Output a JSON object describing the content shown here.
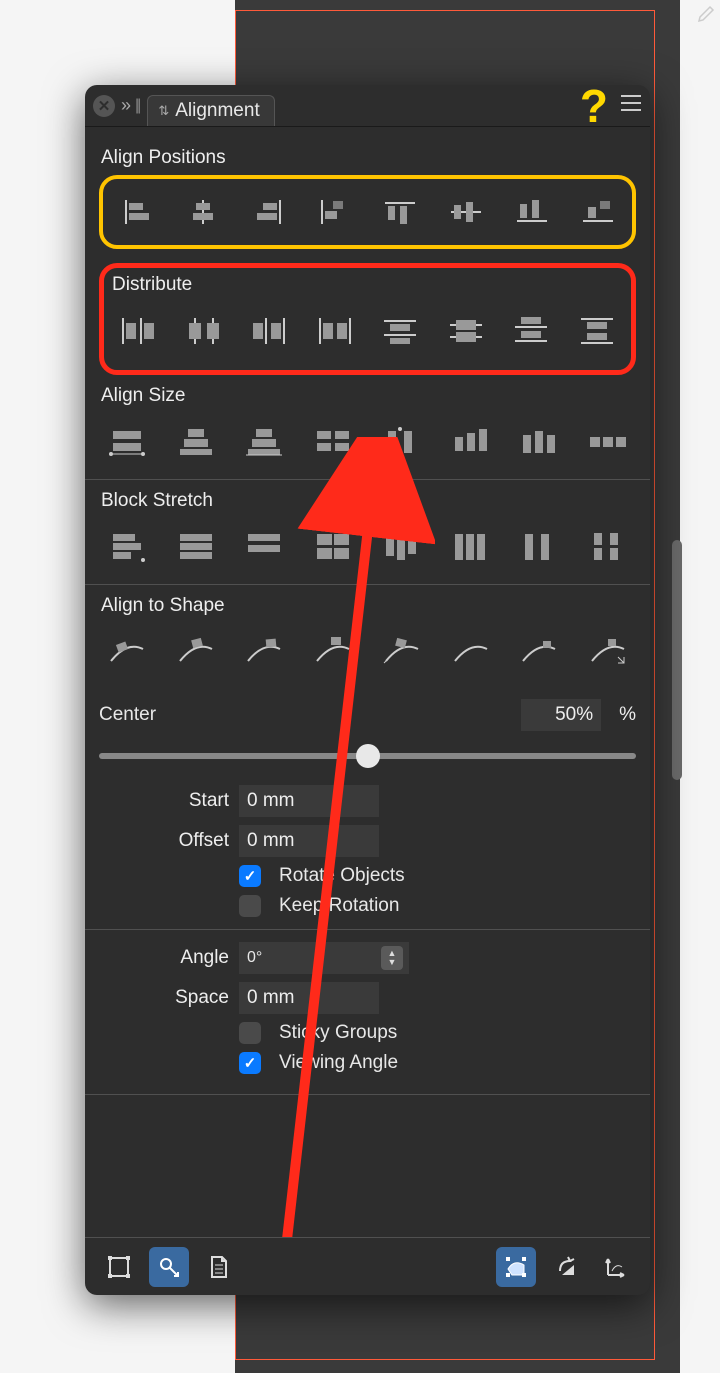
{
  "panel": {
    "title": "Alignment",
    "sections": {
      "align_positions": "Align Positions",
      "distribute": "Distribute",
      "align_size": "Align Size",
      "block_stretch": "Block Stretch",
      "align_to_shape": "Align to Shape"
    },
    "center": {
      "label": "Center",
      "percent_value": "50%",
      "percent_suffix": "%"
    },
    "fields": {
      "start": {
        "label": "Start",
        "value": "0 mm"
      },
      "offset": {
        "label": "Offset",
        "value": "0 mm"
      },
      "angle": {
        "label": "Angle",
        "value": "0°"
      },
      "space": {
        "label": "Space",
        "value": "0 mm"
      }
    },
    "checkboxes": {
      "rotate_objects": {
        "label": "Rotate Objects",
        "checked": true
      },
      "keep_rotation": {
        "label": "Keep Rotation",
        "checked": false
      },
      "sticky_groups": {
        "label": "Sticky Groups",
        "checked": false
      },
      "viewing_angle": {
        "label": "Viewing Angle",
        "checked": true
      }
    }
  },
  "annotation": {
    "question_mark": "?",
    "arrow_color": "#ff2a1a",
    "highlight_yellow": "#ffc400",
    "highlight_red": "#ff2a1a"
  }
}
